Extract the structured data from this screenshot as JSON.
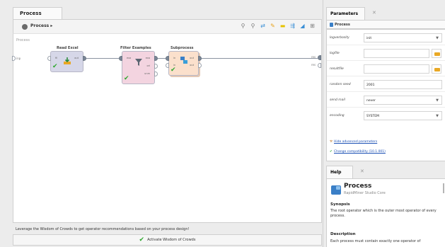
{
  "process_panel": {
    "tab_label": "Process",
    "breadcrumb": "Process",
    "canvas_title": "Process",
    "left_input_port": "inp",
    "right_output_ports": [
      "res",
      "res"
    ],
    "operators": {
      "read_excel": {
        "title": "Read Excel",
        "ports": [
          "fil",
          "out"
        ]
      },
      "filter_examples": {
        "title": "Filter Examples",
        "ports": [
          "exa",
          "exa",
          "ori",
          "unm"
        ]
      },
      "subprocess": {
        "title": "Subprocess",
        "ports": [
          "in",
          "out",
          "in",
          "out"
        ]
      }
    },
    "hint_text": "Leverage the Wisdom of Crowds to get operator recommendations based on your process design!",
    "activate_label": "Activate Wisdom of Crowds"
  },
  "parameters_panel": {
    "tab_label": "Parameters",
    "header": "Process",
    "rows": [
      {
        "label": "logverbosity",
        "value": "init",
        "type": "select"
      },
      {
        "label": "logfile",
        "value": "",
        "type": "file"
      },
      {
        "label": "resultfile",
        "value": "",
        "type": "file"
      },
      {
        "label": "random seed",
        "value": "2001",
        "type": "text"
      },
      {
        "label": "send mail",
        "value": "never",
        "type": "select"
      },
      {
        "label": "encoding",
        "value": "SYSTEM",
        "type": "select"
      }
    ],
    "hide_advanced": "Hide advanced parameters",
    "change_compat": "Change compatibility (10.1.001)"
  },
  "help_panel": {
    "tab_label": "Help",
    "title": "Process",
    "subtitle": "RapidMiner Studio Core",
    "synopsis_heading": "Synopsis",
    "synopsis_text": "The root operator which is the outer most operator of every process.",
    "description_heading": "Description",
    "description_text": "Each process must contain exactly one operator of"
  },
  "colors": {
    "read_excel_bg": "#d6d7e8",
    "filter_bg": "#f3d4e0",
    "subprocess_bg": "#fbe0cc",
    "check_green": "#2ea82e",
    "link_blue": "#1a4fb4"
  }
}
